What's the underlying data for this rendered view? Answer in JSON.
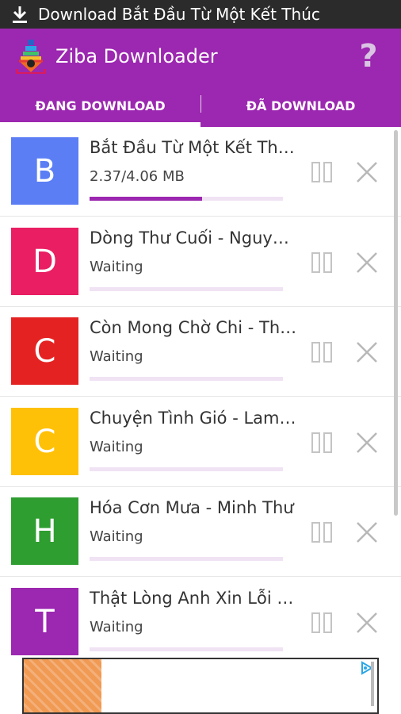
{
  "status_bar": {
    "icon": "download-arrow-icon",
    "notification_text": "Download Bắt Đầu Từ Một Kết Thúc"
  },
  "app_bar": {
    "title": "Ziba Downloader",
    "logo_icon": "ziba-logo-icon",
    "help_label": "?",
    "color": "#9c27b0"
  },
  "tabs": [
    {
      "label": "ĐANG DOWNLOAD",
      "active": true
    },
    {
      "label": "ĐÃ DOWNLOAD",
      "active": false
    }
  ],
  "downloads": [
    {
      "letter": "B",
      "color": "#5b7ef5",
      "title": "Bắt Đầu Từ Một Kết Thúc",
      "status": "2.37/4.06 MB",
      "progress": 0.58
    },
    {
      "letter": "D",
      "color": "#e91e63",
      "title": "Dòng Thư Cuối - Nguyễn Văn",
      "status": "Waiting",
      "progress": 0
    },
    {
      "letter": "C",
      "color": "#e52222",
      "title": "Còn Mong Chờ Chi - Thủy Tiên",
      "status": "Waiting",
      "progress": 0
    },
    {
      "letter": "C",
      "color": "#ffc107",
      "title": "Chuyện Tình Gió - Lam Trường",
      "status": "Waiting",
      "progress": 0
    },
    {
      "letter": "H",
      "color": "#2e9e30",
      "title": "Hóa Cơn Mưa - Minh Thư",
      "status": "Waiting",
      "progress": 0
    },
    {
      "letter": "T",
      "color": "#9c27b0",
      "title": "Thật Lòng Anh Xin Lỗi - Lâm",
      "status": "Waiting",
      "progress": 0
    }
  ],
  "row_actions": {
    "pause_icon": "pause-icon",
    "close_icon": "close-icon"
  },
  "ad": {
    "choices_icon": "ad-choices-icon"
  }
}
